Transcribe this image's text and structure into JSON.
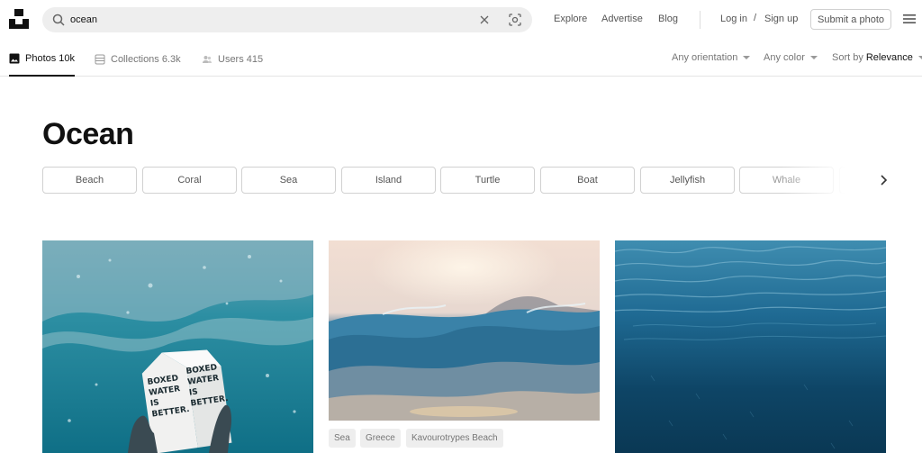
{
  "search": {
    "query": "ocean"
  },
  "nav": {
    "explore": "Explore",
    "advertise": "Advertise",
    "blog": "Blog",
    "login": "Log in",
    "separator": "/",
    "signup": "Sign up",
    "submit": "Submit a photo"
  },
  "tabs": [
    {
      "label": "Photos",
      "count": "10k",
      "icon": "image-icon"
    },
    {
      "label": "Collections",
      "count": "6.3k",
      "icon": "collections-icon"
    },
    {
      "label": "Users",
      "count": "415",
      "icon": "users-icon"
    }
  ],
  "tab_labels": {
    "photos": "Photos 10k",
    "collections": "Collections 6.3k",
    "users": "Users 415"
  },
  "filters": {
    "orientation": "Any orientation",
    "color": "Any color",
    "sort_prefix": "Sort by",
    "sort_value": "Relevance"
  },
  "page_title": "Ocean",
  "related": [
    "Beach",
    "Coral",
    "Sea",
    "Island",
    "Turtle",
    "Boat",
    "Jellyfish",
    "Whale"
  ],
  "photo_tags": [
    "Sea",
    "Greece",
    "Kavourotrypes Beach"
  ],
  "photo_text": {
    "carton_left": [
      "BOXED",
      "WATER",
      "IS",
      "BETTER."
    ],
    "carton_right": [
      "BOXED",
      "WATER",
      "IS",
      "BETTER."
    ]
  },
  "colors": {
    "brand": "#111111",
    "chip_border": "#d1d1d1",
    "muted": "#767676"
  }
}
